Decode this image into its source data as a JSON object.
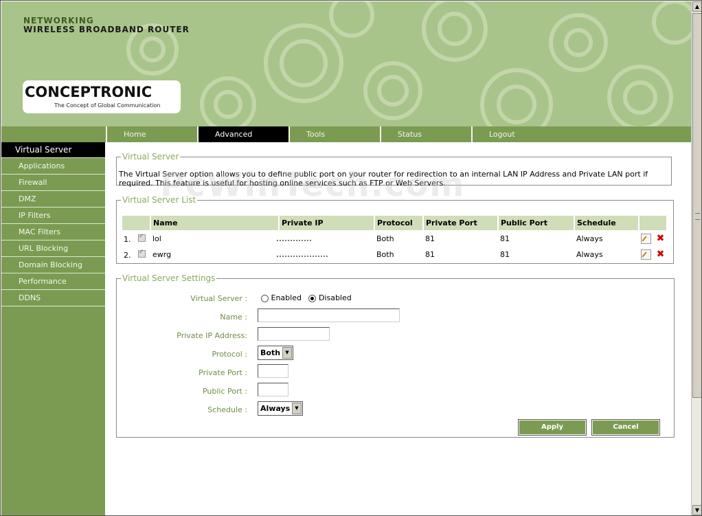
{
  "header": {
    "brand_line1": "NETWORKING",
    "brand_line2": "WIRELESS BROADBAND ROUTER",
    "logo_text": "CONCEPTRONIC",
    "logo_tagline": "The Concept of Global Communication"
  },
  "watermark": "PcWinTech.com",
  "nav": {
    "tabs": [
      {
        "label": "Home"
      },
      {
        "label": "Advanced"
      },
      {
        "label": "Tools"
      },
      {
        "label": "Status"
      },
      {
        "label": "Logout"
      }
    ],
    "active": "Advanced"
  },
  "sidebar": {
    "items": [
      {
        "label": "Virtual Server"
      },
      {
        "label": "Applications"
      },
      {
        "label": "Firewall"
      },
      {
        "label": "DMZ"
      },
      {
        "label": "IP Filters"
      },
      {
        "label": "MAC Filters"
      },
      {
        "label": "URL Blocking"
      },
      {
        "label": "Domain Blocking"
      },
      {
        "label": "Performance"
      },
      {
        "label": "DDNS"
      }
    ],
    "active": "Virtual Server"
  },
  "intro": {
    "legend": "Virtual Server",
    "text": "The Virtual Server option allows you to define public port on your router for redirection to an internal LAN IP Address and Private LAN port if required. This feature is useful for hosting online services such as FTP or Web Servers."
  },
  "list": {
    "legend": "Virtual Server List",
    "columns": [
      "Name",
      "Private IP",
      "Protocol",
      "Private Port",
      "Public Port",
      "Schedule"
    ],
    "rows": [
      {
        "index": "1.",
        "name": "lol",
        "protocol": "Both",
        "private_port": "81",
        "public_port": "81",
        "schedule": "Always"
      },
      {
        "index": "2.",
        "name": "ewrg",
        "protocol": "Both",
        "private_port": "81",
        "public_port": "81",
        "schedule": "Always"
      }
    ]
  },
  "settings": {
    "legend": "Virtual Server Settings",
    "virtual_server_label": "Virtual Server :",
    "enabled_label": "Enabled",
    "disabled_label": "Disabled",
    "selected": "Disabled",
    "name_label": "Name :",
    "name_value": "",
    "private_ip_label": "Private IP Address:",
    "private_ip_value": "",
    "protocol_label": "Protocol :",
    "protocol_value": "Both",
    "private_port_label": "Private Port :",
    "private_port_value": "",
    "public_port_label": "Public Port :",
    "public_port_value": "",
    "schedule_label": "Schedule :",
    "schedule_value": "Always",
    "apply_label": "Apply",
    "cancel_label": "Cancel"
  },
  "colors": {
    "header_bg": "#a9c48a",
    "nav_green": "#7c9b52",
    "legend_green": "#8aaa5a",
    "header_cell": "#cfddb8",
    "active_black": "#000000"
  },
  "icons": {
    "edit": "edit-icon",
    "delete": "delete-icon",
    "scroll_up": "scroll-up-arrow-icon",
    "scroll_down": "scroll-down-arrow-icon"
  }
}
